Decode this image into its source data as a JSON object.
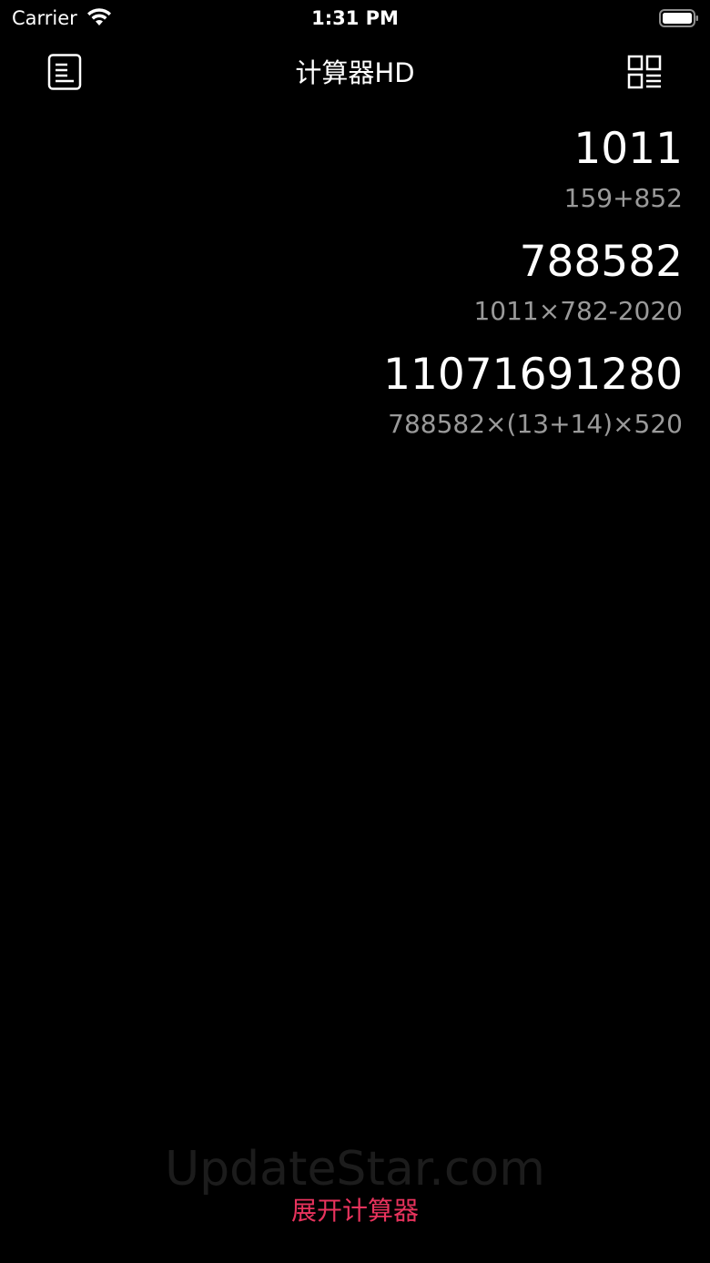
{
  "status_bar": {
    "carrier": "Carrier",
    "time": "1:31 PM"
  },
  "nav": {
    "title": "计算器HD",
    "left_icon": "history-list-icon",
    "right_icon": "grid-menu-icon"
  },
  "history": [
    {
      "result": "1011",
      "expression": "159+852"
    },
    {
      "result": "788582",
      "expression": "1011×782-2020"
    },
    {
      "result": "11071691280",
      "expression": "788582×(13+14)×520"
    }
  ],
  "footer": {
    "watermark": "UpdateStar.com",
    "expand_label": "展开计算器"
  },
  "colors": {
    "background": "#000000",
    "text": "#ffffff",
    "secondary_text": "#9a9a9a",
    "accent": "#e8335d"
  }
}
